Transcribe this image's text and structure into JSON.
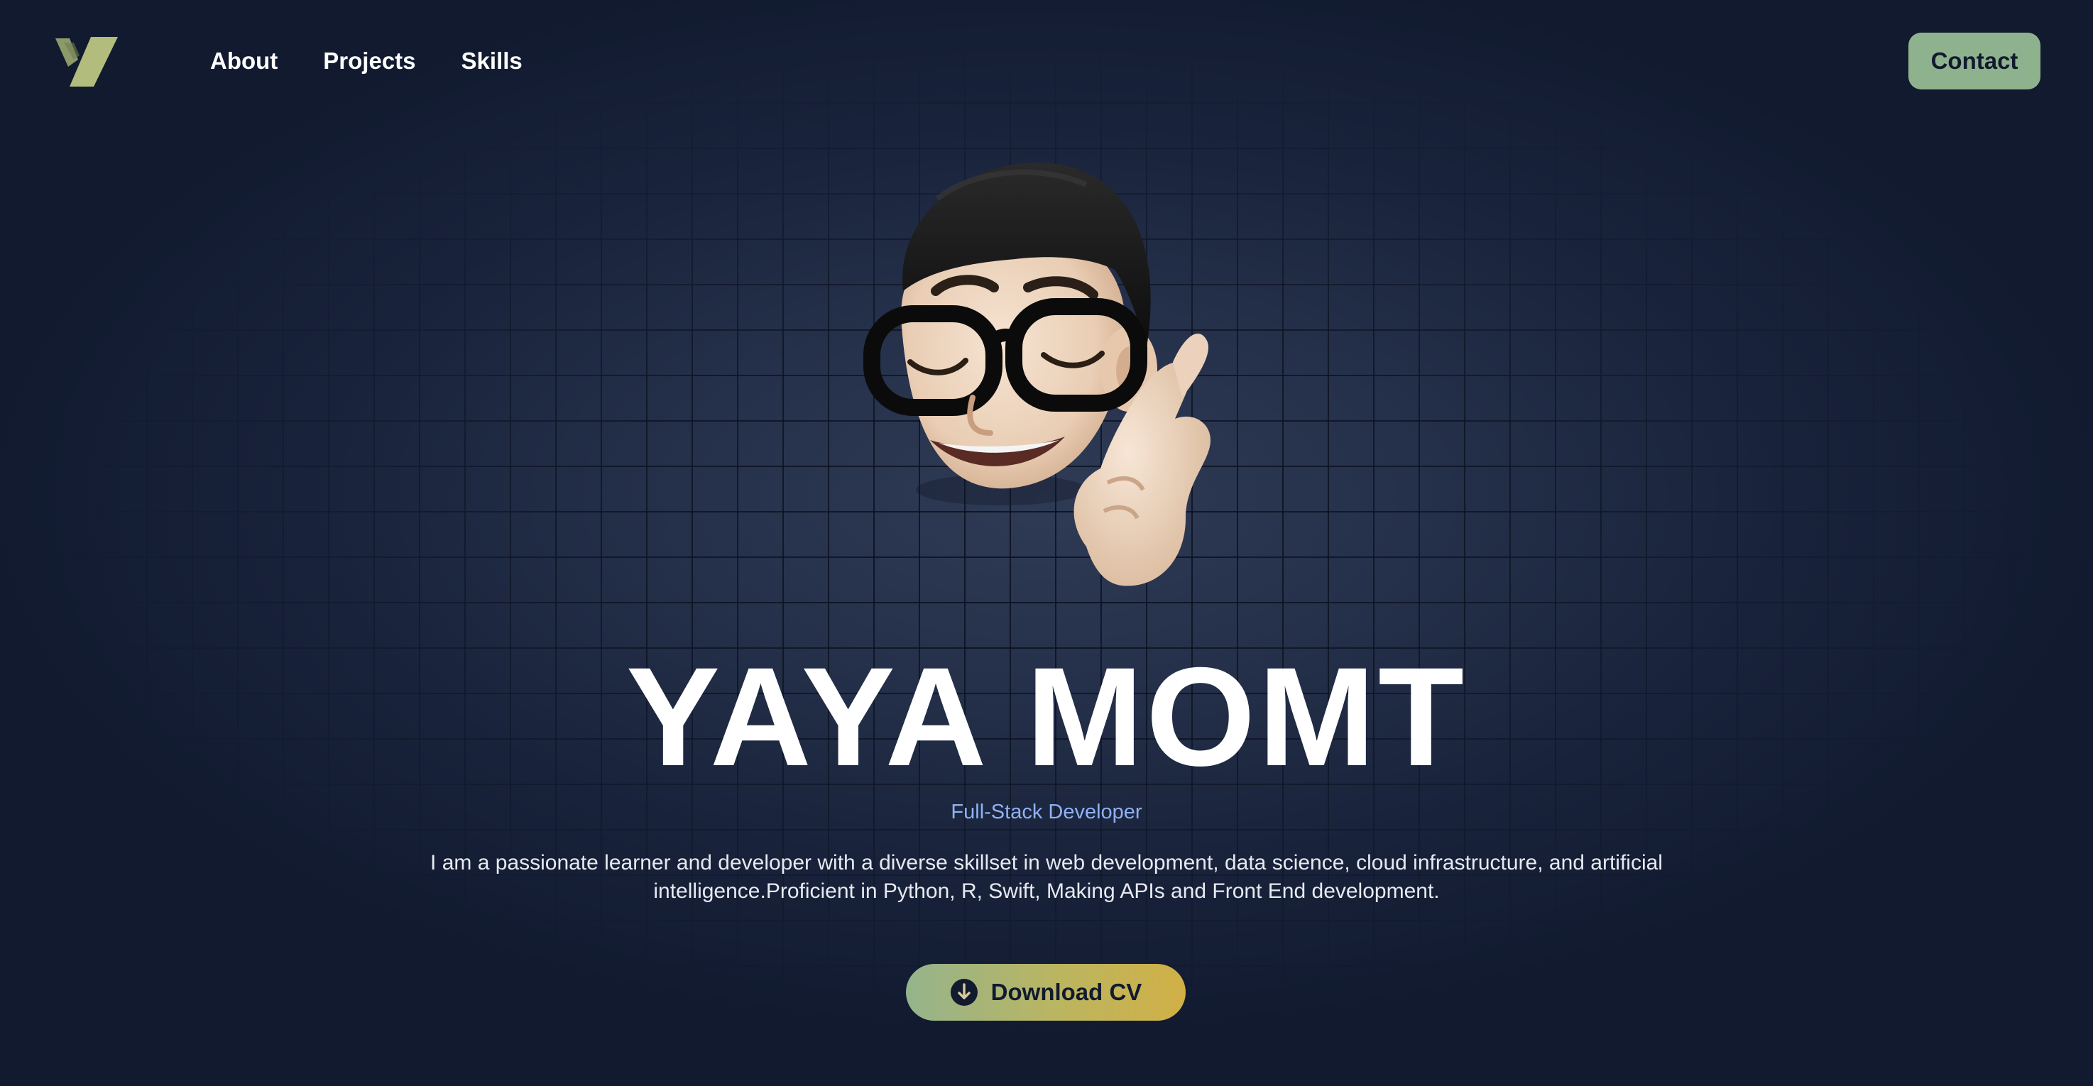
{
  "header": {
    "nav": [
      {
        "label": "About"
      },
      {
        "label": "Projects"
      },
      {
        "label": "Skills"
      }
    ],
    "contact_label": "Contact"
  },
  "hero": {
    "name": "YAYA MOMT",
    "role": "Full-Stack Developer",
    "description": "I am a passionate learner and developer with a diverse skillset in web development, data science, cloud infrastructure, and artificial intelligence.Proficient in Python, R, Swift, Making APIs and Front End development.",
    "download_label": "Download CV"
  },
  "icons": {
    "logo": "y-logo-icon",
    "download": "arrow-down-circle-icon",
    "avatar": "memoji-avatar"
  },
  "colors": {
    "background": "#111a2f",
    "accent_green": "#8fb28e",
    "accent_gold": "#d1b046",
    "role_blue": "#8fb1f4",
    "logo_olive": "#a9b57a"
  }
}
